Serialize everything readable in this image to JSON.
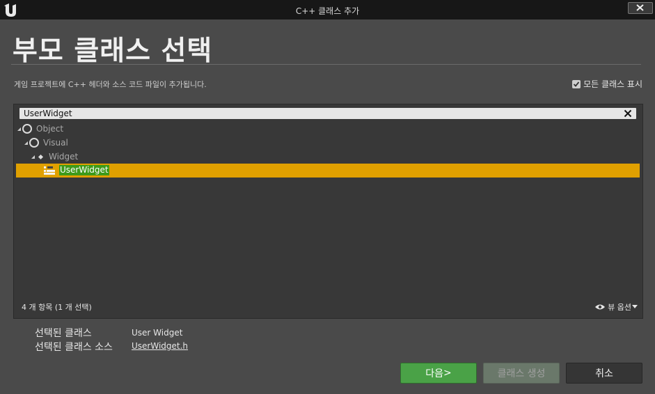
{
  "window": {
    "title": "C++ 클래스 추가"
  },
  "page": {
    "heading": "부모 클래스 선택",
    "description": "게임 프로젝트에 C++ 헤더와 소스 코드 파일이 추가됩니다.",
    "show_all_label": "모든 클래스 표시",
    "show_all_checked": true
  },
  "search": {
    "value": "UserWidget"
  },
  "tree": [
    {
      "label": "Object",
      "icon": "class-ring-icon",
      "expanded": true
    },
    {
      "label": "Visual",
      "icon": "class-ring-icon",
      "expanded": true
    },
    {
      "label": "Widget",
      "icon": "class-diamond-icon",
      "expanded": true
    },
    {
      "label": "UserWidget",
      "icon": "user-widget-icon",
      "selected": true
    }
  ],
  "panel_footer": {
    "item_count": "4 개 항목 (1 개 선택)",
    "view_options": "뷰 옵션"
  },
  "selection": {
    "class_label": "선택된 클래스",
    "class_value": "User Widget",
    "source_label": "선택된 클래스 소스",
    "source_value": "UserWidget.h"
  },
  "buttons": {
    "next": "다음",
    "next_suffix": ">",
    "create": "클래스 생성",
    "cancel": "취소"
  },
  "colors": {
    "selected_row": "#e0a000",
    "highlight": "#3d9a1a",
    "primary_button": "#4aa247"
  }
}
